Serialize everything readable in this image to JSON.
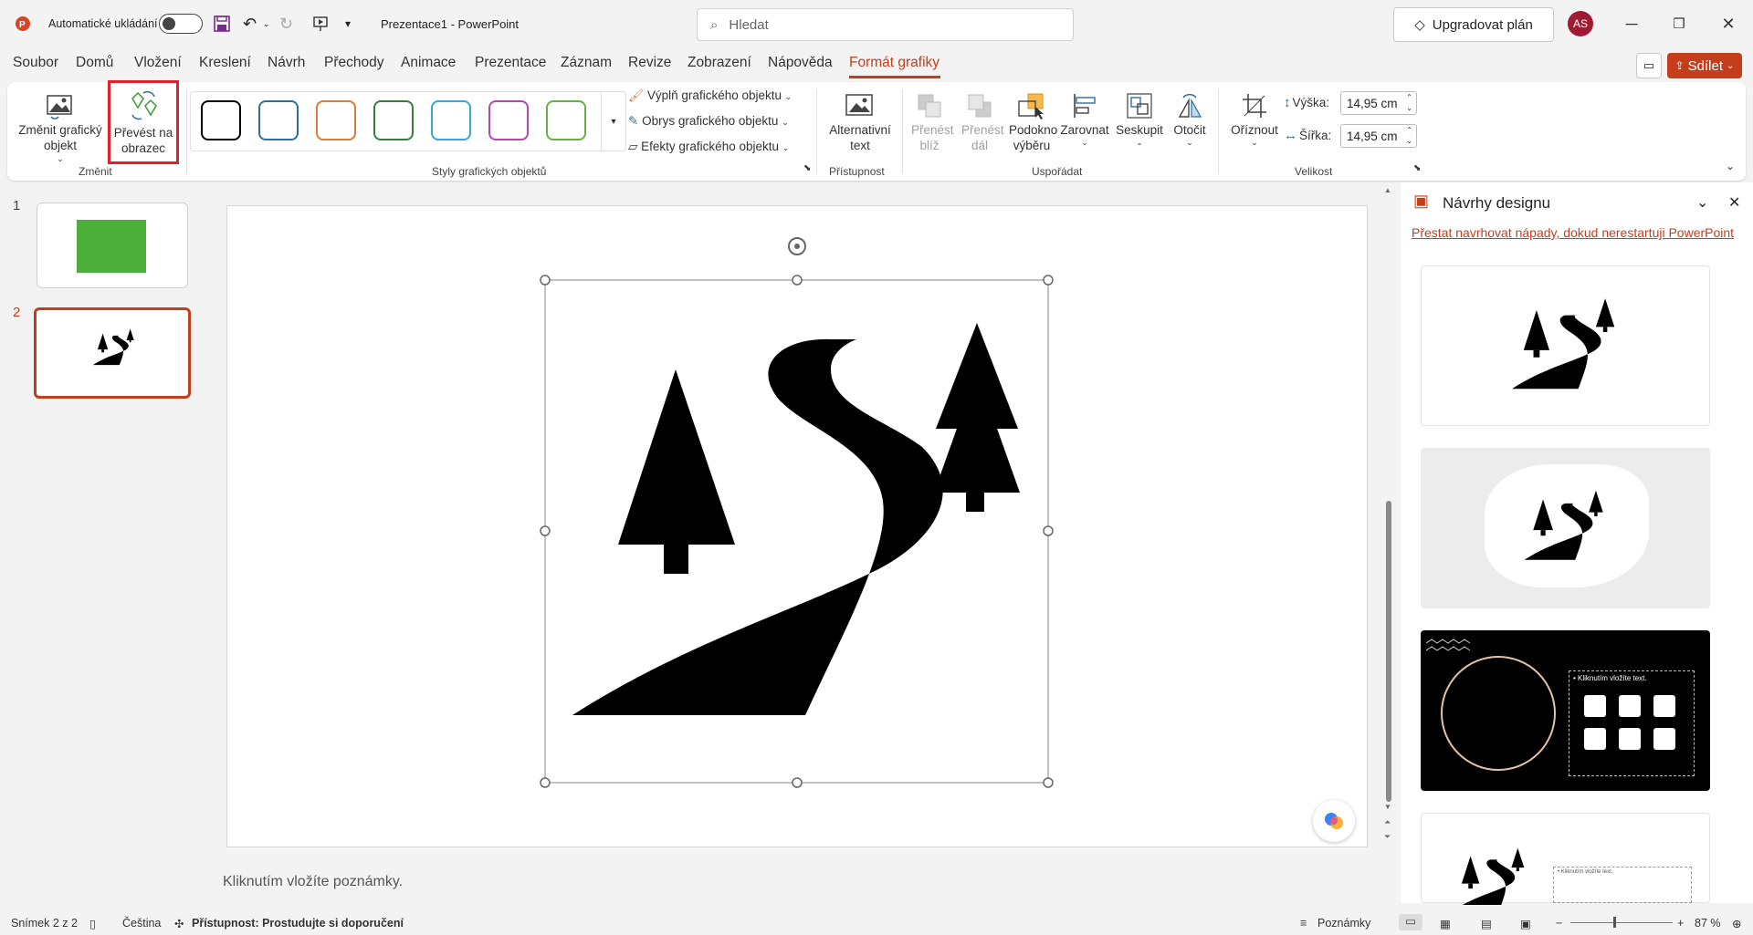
{
  "titlebar": {
    "autosave_label": "Automatické ukládání",
    "doc_title": "Prezentace1  -  PowerPoint",
    "search_placeholder": "Hledat",
    "upgrade_label": "Upgradovat plán",
    "avatar_initials": "AS"
  },
  "menu": {
    "items": [
      "Soubor",
      "Domů",
      "Vložení",
      "Kreslení",
      "Návrh",
      "Přechody",
      "Animace",
      "Prezentace",
      "Záznam",
      "Revize",
      "Zobrazení",
      "Nápověda",
      "Formát grafiky"
    ],
    "share_label": "Sdílet"
  },
  "ribbon": {
    "change_graphic": "Změnit grafický objekt",
    "convert_to_shape": "Převést na obrazec",
    "group_change": "Změnit",
    "group_styles": "Styly grafických objektů",
    "fill": "Výplň grafického objektu",
    "outline": "Obrys grafického objektu",
    "effects": "Efekty grafického objektu",
    "alt_text": "Alternativní text",
    "group_accessibility": "Přístupnost",
    "bring_forward": "Přenést blíž",
    "send_backward": "Přenést dál",
    "selection_pane": "Podokno výběru",
    "align": "Zarovnat",
    "group": "Seskupit",
    "rotate": "Otočit",
    "group_arrange": "Uspořádat",
    "crop": "Oříznout",
    "height_label": "Výška:",
    "height_value": "14,95 cm",
    "width_label": "Šířka:",
    "width_value": "14,95 cm",
    "group_size": "Velikost"
  },
  "style_colors": [
    "#000000",
    "#2e6e9e",
    "#e07b39",
    "#3a7d3a",
    "#3aa5d6",
    "#b04ab0",
    "#6ab04a"
  ],
  "slides": [
    {
      "num": "1",
      "color": "#4caf3a"
    },
    {
      "num": "2"
    }
  ],
  "notes_placeholder": "Kliknutím vložíte poznámky.",
  "design_panel": {
    "title": "Návrhy designu",
    "stop_link": "Přestat navrhovat nápady, dokud nerestartuji PowerPoint",
    "card3_text": "• Kliknutím vložíte text.",
    "card4_text": "• Kliknutím vložíte text."
  },
  "status": {
    "slide_info": "Snímek 2 z 2",
    "language": "Čeština",
    "accessibility": "Přístupnost: Prostudujte si doporučení",
    "notes_btn": "Poznámky",
    "zoom": "87 %"
  },
  "accent_color": "#c43e1c"
}
